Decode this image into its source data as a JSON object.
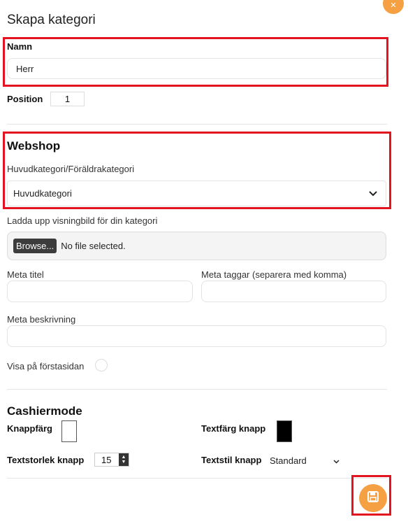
{
  "modal": {
    "title": "Skapa kategori"
  },
  "name_field": {
    "label": "Namn",
    "value": "Herr"
  },
  "position_field": {
    "label": "Position",
    "value": "1"
  },
  "webshop": {
    "heading": "Webshop",
    "parent_label": "Huvudkategori/Föräldrakategori",
    "parent_value": "Huvudkategori",
    "upload_label": "Ladda upp visningbild för din kategori",
    "browse_label": "Browse...",
    "file_status": "No file selected.",
    "meta_title_label": "Meta titel",
    "meta_title_value": "",
    "meta_tags_label": "Meta taggar (separera med komma)",
    "meta_tags_value": "",
    "meta_desc_label": "Meta beskrivning",
    "meta_desc_value": "",
    "show_front_label": "Visa på förstasidan"
  },
  "cashiermode": {
    "heading": "Cashiermode",
    "button_color_label": "Knappfärg",
    "button_color": "#ffffff",
    "text_color_label": "Textfärg knapp",
    "text_color": "#000000",
    "text_size_label": "Textstorlek knapp",
    "text_size_value": "15",
    "text_style_label": "Textstil knapp",
    "text_style_value": "Standard"
  },
  "colors": {
    "accent": "#f5a042",
    "highlight": "#e3141f"
  },
  "icons": {
    "close": "close-icon",
    "dropdown": "chevron-down-icon",
    "save": "floppy-disk-icon"
  }
}
